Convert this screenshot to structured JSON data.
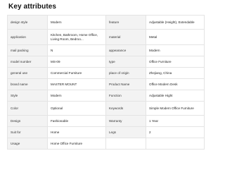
{
  "section": {
    "title": "Key attributes"
  },
  "attributes": [
    {
      "k1": "design style",
      "v1": "Modern",
      "k2": "feature",
      "v2": "Adjustable (Height), Extendable"
    },
    {
      "k1": "application",
      "v1": "Kitchen, Bathroom, Home Office, Living Room, Bedroo...",
      "k2": "material",
      "v2": "Metal"
    },
    {
      "k1": "mail packing",
      "v1": "N",
      "k2": "appearance",
      "v2": "Modern"
    },
    {
      "k1": "model number",
      "v1": "MS-09",
      "k2": "type",
      "v2": "Office Furniture"
    },
    {
      "k1": "general use",
      "v1": "Commercial Furniture",
      "k2": "place of origin",
      "v2": "Zhejiang, China"
    },
    {
      "k1": "brand name",
      "v1": "MASTER MOUNT",
      "k2": "Product Name",
      "v2": "Office Modern Desk"
    },
    {
      "k1": "Style",
      "v1": "Modern",
      "k2": "Function",
      "v2": "Adjustable Hight"
    },
    {
      "k1": "Color",
      "v1": "Optional",
      "k2": "Keywords",
      "v2": "Simple Modern Office Furniture"
    },
    {
      "k1": "Design",
      "v1": "Fashionable",
      "k2": "Warranty",
      "v2": "1 Year"
    },
    {
      "k1": "Suit for",
      "v1": "Home",
      "k2": "Legs",
      "v2": "2"
    },
    {
      "k1": "Usage",
      "v1": "Home Office Furniture",
      "k2": "",
      "v2": ""
    }
  ]
}
